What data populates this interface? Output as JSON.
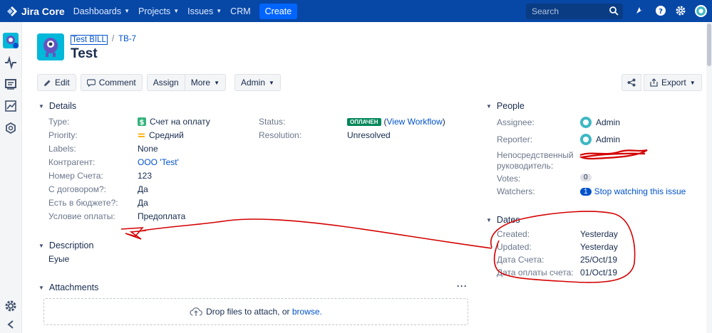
{
  "nav": {
    "logo": "Jira Core",
    "items": [
      "Dashboards",
      "Projects",
      "Issues",
      "CRM"
    ],
    "create": "Create",
    "search_placeholder": "Search"
  },
  "breadcrumb": {
    "project": "Test BILL",
    "key": "TB-7"
  },
  "issue": {
    "title": "Test"
  },
  "toolbar": {
    "edit": "Edit",
    "comment": "Comment",
    "assign": "Assign",
    "more": "More",
    "admin": "Admin",
    "export": "Export"
  },
  "details": {
    "heading": "Details",
    "type_label": "Type:",
    "type_value": "Счет на оплату",
    "priority_label": "Priority:",
    "priority_value": "Средний",
    "labels_label": "Labels:",
    "labels_value": "None",
    "contractor_label": "Контрагент:",
    "contractor_value": "ООО 'Test'",
    "number_label": "Номер Счета:",
    "number_value": "123",
    "contract_label": "С договором?:",
    "contract_value": "Да",
    "budget_label": "Есть в бюджете?:",
    "budget_value": "Да",
    "payment_label": "Условие оплаты:",
    "payment_value": "Предоплата",
    "status_label": "Status:",
    "status_badge": "ОПЛАЧЕН",
    "status_open": "(",
    "status_workflow": "View Workflow",
    "status_close": ")",
    "resolution_label": "Resolution:",
    "resolution_value": "Unresolved"
  },
  "description": {
    "heading": "Description",
    "text": "Еуые"
  },
  "attachments": {
    "heading": "Attachments",
    "more": "···",
    "drop_text": "Drop files to attach, or ",
    "browse": "browse."
  },
  "people": {
    "heading": "People",
    "assignee_label": "Assignee:",
    "assignee_value": "Admin",
    "reporter_label": "Reporter:",
    "reporter_value": "Admin",
    "manager_label_1": "Непосредственный",
    "manager_label_2": "руководитель:",
    "votes_label": "Votes:",
    "votes_value": "0",
    "watchers_label": "Watchers:",
    "watchers_count": "1",
    "watchers_link": "Stop watching this issue"
  },
  "dates": {
    "heading": "Dates",
    "created_label": "Created:",
    "created_value": "Yesterday",
    "updated_label": "Updated:",
    "updated_value": "Yesterday",
    "invoice_label": "Дата Счета:",
    "invoice_value": "25/Oct/19",
    "paydate_label": "Дата оплаты счета:",
    "paydate_value": "01/Oct/19"
  },
  "colors": {
    "nav": "#0747a6",
    "link": "#0052cc",
    "annotation": "#d40000"
  }
}
